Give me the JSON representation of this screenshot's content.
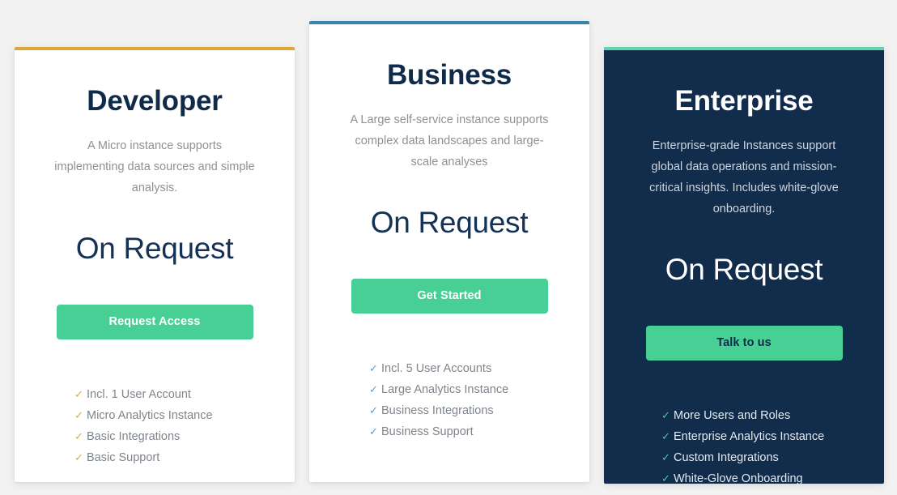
{
  "page": {
    "background_color": "#f2f2f2"
  },
  "cards": [
    {
      "id": "developer",
      "accent_color": "#dda73c",
      "name": "Developer",
      "description": "A Micro instance supports implementing data sources and simple analysis.",
      "price": "On Request",
      "cta_label": "Request Access",
      "cta_color": "#47cf95",
      "check_color": "#e0a83c",
      "check_glyph": "✓",
      "features": [
        "Incl. 1 User Account",
        "Micro Analytics Instance",
        "Basic Integrations",
        "Basic Support"
      ]
    },
    {
      "id": "business",
      "accent_color": "#3b83ae",
      "name": "Business",
      "description": "A Large self-service instance supports complex data landscapes and large-scale analyses",
      "price": "On Request",
      "cta_label": "Get Started",
      "cta_color": "#47cf95",
      "check_color": "#5d9ec9",
      "check_glyph": "✓",
      "features": [
        "Incl. 5 User Accounts",
        "Large Analytics Instance",
        "Business Integrations",
        "Business Support"
      ]
    },
    {
      "id": "enterprise",
      "accent_color": "#5fd6ad",
      "background_color": "#122c4b",
      "name": "Enterprise",
      "description": "Enterprise-grade Instances support global data operations and mission-critical insights. Includes white-glove onboarding.",
      "price": "On Request",
      "cta_label": "Talk to us",
      "cta_color": "#47cf95",
      "check_color": "#47cf95",
      "check_glyph": "✓",
      "features": [
        "More Users and Roles",
        "Enterprise Analytics Instance",
        "Custom Integrations",
        "White-Glove Onboarding"
      ]
    }
  ]
}
